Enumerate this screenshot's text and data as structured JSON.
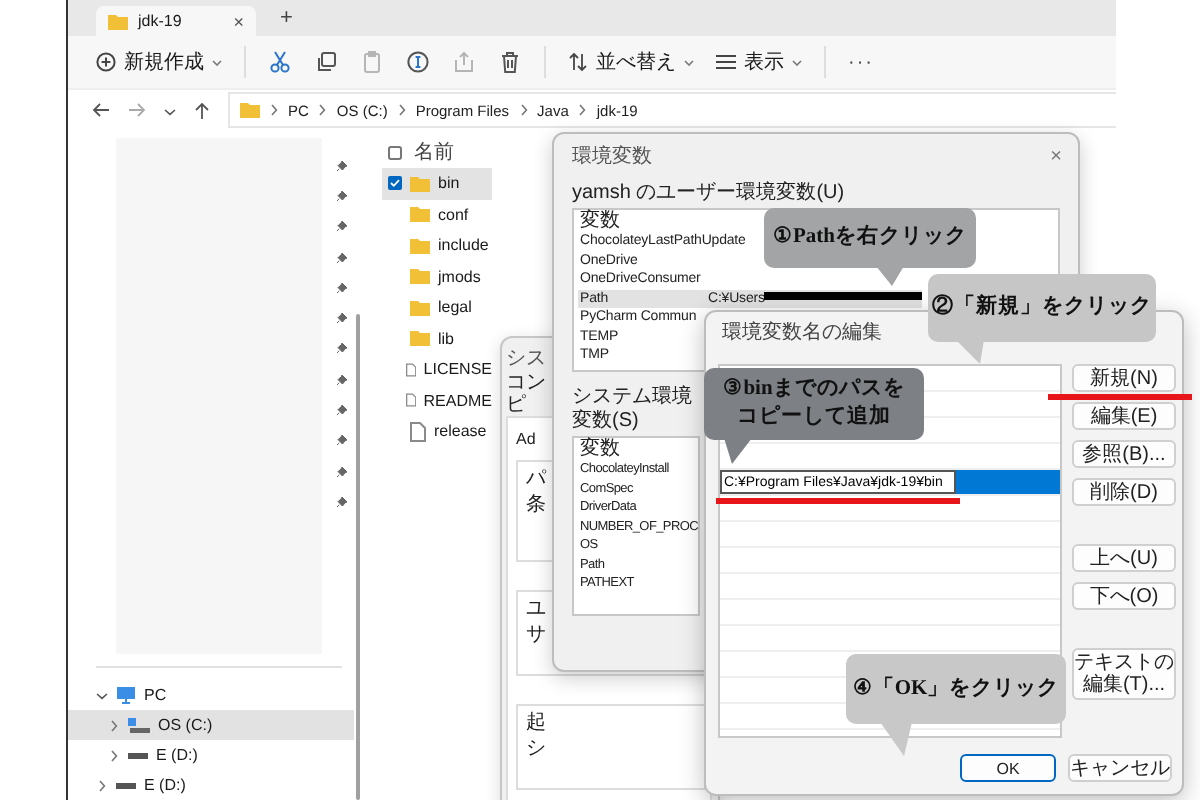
{
  "explorer": {
    "tab": {
      "title": "jdk-19",
      "close": "×"
    },
    "new_tab": "+",
    "toolbar": [
      {
        "kind": "new",
        "label": "新規作成",
        "disabled": false
      },
      {
        "kind": "cut",
        "disabled": false
      },
      {
        "kind": "copy",
        "disabled": false
      },
      {
        "kind": "paste",
        "disabled": true
      },
      {
        "kind": "rename",
        "disabled": false
      },
      {
        "kind": "share",
        "disabled": true
      },
      {
        "kind": "delete",
        "disabled": false
      },
      {
        "kind": "sort",
        "label": "並べ替え",
        "disabled": false
      },
      {
        "kind": "view",
        "label": "表示",
        "disabled": false
      },
      {
        "kind": "more",
        "label": "···",
        "disabled": false
      }
    ],
    "breadcrumb": [
      "PC",
      "OS (C:)",
      "Program Files",
      "Java",
      "jdk-19"
    ],
    "nav_tree": [
      {
        "label": "PC",
        "kind": "pc",
        "expanded": true,
        "selected": false,
        "children": [
          {
            "label": "OS (C:)",
            "kind": "system-drive",
            "expanded": false,
            "selected": true
          },
          {
            "label": "E (D:)",
            "kind": "drive",
            "expanded": false,
            "selected": false
          }
        ]
      },
      {
        "label": "E (D:)",
        "kind": "drive",
        "expanded": false,
        "selected": false
      }
    ],
    "files": {
      "column": "名前",
      "all_checked": false,
      "rows": [
        {
          "name": "bin",
          "kind": "folder",
          "selected": true
        },
        {
          "name": "conf",
          "kind": "folder",
          "selected": false
        },
        {
          "name": "include",
          "kind": "folder",
          "selected": false
        },
        {
          "name": "jmods",
          "kind": "folder",
          "selected": false
        },
        {
          "name": "legal",
          "kind": "folder",
          "selected": false
        },
        {
          "name": "lib",
          "kind": "folder",
          "selected": false
        },
        {
          "name": "LICENSE",
          "kind": "file",
          "selected": false
        },
        {
          "name": "README",
          "kind": "file",
          "selected": false
        },
        {
          "name": "release",
          "kind": "file",
          "selected": false
        }
      ]
    }
  },
  "system_properties": {
    "title": "シス",
    "tab": "コンピ",
    "labels": [
      "Ad",
      "パ",
      "条",
      "ユ",
      "サ",
      "起",
      "シ"
    ]
  },
  "env_dialog": {
    "title": "環境変数",
    "close": "×",
    "user_group": "yamsh のユーザー環境変数(U)",
    "user_vars": {
      "column": "変数",
      "rows": [
        {
          "name": "ChocolateyLastPathUpdate",
          "selected": false
        },
        {
          "name": "OneDrive",
          "selected": false
        },
        {
          "name": "OneDriveConsumer",
          "selected": false
        },
        {
          "name": "Path",
          "value": "C:¥Users",
          "redacted": true,
          "selected": true
        },
        {
          "name": "PyCharm Commun",
          "selected": false
        },
        {
          "name": "TEMP",
          "selected": false
        },
        {
          "name": "TMP",
          "selected": false
        }
      ]
    },
    "system_group": "システム環境変数(S)",
    "system_vars": {
      "column": "変数",
      "rows": [
        "ChocolateyInstall",
        "ComSpec",
        "DriverData",
        "NUMBER_OF_PROC",
        "OS",
        "Path",
        "PATHEXT"
      ]
    }
  },
  "edit_dialog": {
    "title": "環境変数名の編集",
    "entry": "C:¥Program Files¥Java¥jdk-19¥bin",
    "buttons": [
      "新規(N)",
      "編集(E)",
      "参照(B)...",
      "削除(D)",
      "上へ(U)",
      "下へ(O)",
      "テキストの編集(T)..."
    ],
    "ok": "OK",
    "cancel": "キャンセル"
  },
  "callouts": [
    {
      "lines": [
        "①Pathを右クリック"
      ],
      "color": "#a3a4a6"
    },
    {
      "lines": [
        "②「新規」をクリック"
      ],
      "color": "#c6c6c6"
    },
    {
      "lines": [
        "③binまでのパスを",
        "コピーして追加"
      ],
      "color": "#7d8084"
    },
    {
      "lines": [
        "④「OK」をクリック"
      ],
      "color": "#c8c8c8"
    }
  ]
}
